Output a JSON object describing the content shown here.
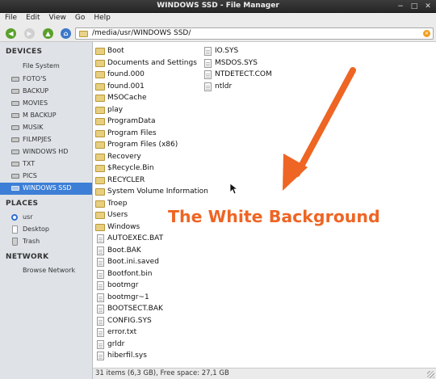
{
  "window": {
    "title": "WINDOWS SSD - File Manager",
    "controls": [
      "−",
      "□",
      "✕"
    ]
  },
  "menubar": [
    "File",
    "Edit",
    "View",
    "Go",
    "Help"
  ],
  "toolbar": {
    "path": "/media/usr/WINDOWS SSD/"
  },
  "sidebar": {
    "devices_heading": "DEVICES",
    "devices": [
      {
        "label": "File System",
        "icon": "none",
        "active": false
      },
      {
        "label": "FOTO'S",
        "icon": "drive-icon",
        "active": false
      },
      {
        "label": "BACKUP",
        "icon": "drive-icon",
        "active": false
      },
      {
        "label": "MOVIES",
        "icon": "drive-icon",
        "active": false
      },
      {
        "label": "M BACKUP",
        "icon": "drive-icon",
        "active": false
      },
      {
        "label": "MUSIK",
        "icon": "drive-icon",
        "active": false
      },
      {
        "label": "FILMPJES",
        "icon": "drive-icon",
        "active": false
      },
      {
        "label": "WINDOWS HD",
        "icon": "drive-icon",
        "active": false
      },
      {
        "label": "TXT",
        "icon": "drive-icon",
        "active": false
      },
      {
        "label": "PICS",
        "icon": "drive-icon",
        "active": false
      },
      {
        "label": "WINDOWS SSD",
        "icon": "drive-icon",
        "active": true
      }
    ],
    "places_heading": "PLACES",
    "places": [
      {
        "label": "usr",
        "icon": "home-icon"
      },
      {
        "label": "Desktop",
        "icon": "desktop-icon"
      },
      {
        "label": "Trash",
        "icon": "trash-icon"
      }
    ],
    "network_heading": "NETWORK",
    "network": [
      {
        "label": "Browse Network"
      }
    ]
  },
  "files": {
    "column1": [
      {
        "name": "Boot",
        "type": "folder"
      },
      {
        "name": "Documents and Settings",
        "type": "folder"
      },
      {
        "name": "found.000",
        "type": "folder"
      },
      {
        "name": "found.001",
        "type": "folder"
      },
      {
        "name": "MSOCache",
        "type": "folder"
      },
      {
        "name": "play",
        "type": "folder"
      },
      {
        "name": "ProgramData",
        "type": "folder"
      },
      {
        "name": "Program Files",
        "type": "folder"
      },
      {
        "name": "Program Files (x86)",
        "type": "folder"
      },
      {
        "name": "Recovery",
        "type": "folder"
      },
      {
        "name": "$Recycle.Bin",
        "type": "folder"
      },
      {
        "name": "RECYCLER",
        "type": "folder"
      },
      {
        "name": "System Volume Information",
        "type": "folder"
      },
      {
        "name": "Troep",
        "type": "folder"
      },
      {
        "name": "Users",
        "type": "folder"
      },
      {
        "name": "Windows",
        "type": "folder"
      },
      {
        "name": "AUTOEXEC.BAT",
        "type": "file"
      },
      {
        "name": "Boot.BAK",
        "type": "file"
      },
      {
        "name": "Boot.ini.saved",
        "type": "file"
      },
      {
        "name": "Bootfont.bin",
        "type": "file"
      },
      {
        "name": "bootmgr",
        "type": "file"
      },
      {
        "name": "bootmgr~1",
        "type": "file"
      },
      {
        "name": "BOOTSECT.BAK",
        "type": "file"
      },
      {
        "name": "CONFIG.SYS",
        "type": "file"
      },
      {
        "name": "error.txt",
        "type": "file"
      },
      {
        "name": "grldr",
        "type": "file"
      },
      {
        "name": "hiberfil.sys",
        "type": "file"
      }
    ],
    "column2": [
      {
        "name": "IO.SYS",
        "type": "file"
      },
      {
        "name": "MSDOS.SYS",
        "type": "file"
      },
      {
        "name": "NTDETECT.COM",
        "type": "file"
      },
      {
        "name": "ntldr",
        "type": "file"
      }
    ]
  },
  "status": "31 items (6,3 GB), Free space: 27,1 GB",
  "annotation": {
    "text": "The White Background",
    "color": "#ee6524"
  }
}
